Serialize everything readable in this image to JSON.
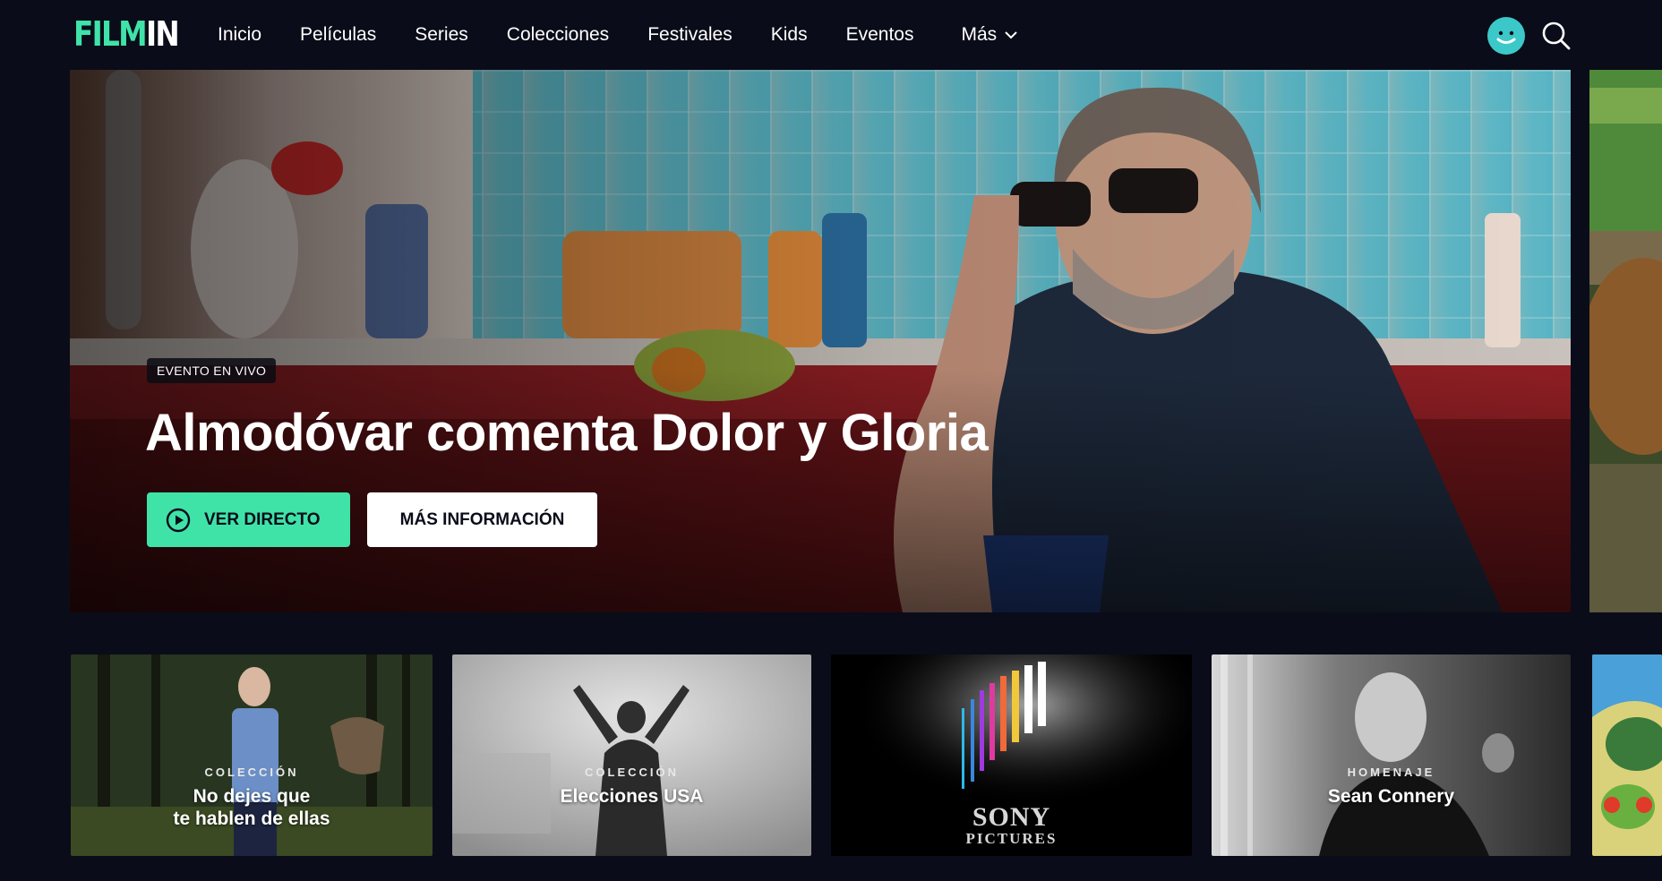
{
  "brand": {
    "logo_primary": "FILM",
    "logo_secondary": "IN",
    "accent_color": "#3fe3a8"
  },
  "nav": {
    "items": [
      "Inicio",
      "Películas",
      "Series",
      "Colecciones",
      "Festivales",
      "Kids",
      "Eventos"
    ],
    "more_label": "Más",
    "avatar_icon": "avatar-smiley-icon",
    "search_icon": "search-icon"
  },
  "hero": {
    "badge": "EVENTO EN VIVO",
    "title": "Almodóvar comenta Dolor y Gloria",
    "primary_button": "VER DIRECTO",
    "secondary_button": "MÁS INFORMACIÓN"
  },
  "row": {
    "cards": [
      {
        "kicker": "COLECCIÓN",
        "title_line1": "No dejes que",
        "title_line2": "te hablen de ellas"
      },
      {
        "kicker": "COLECCIÓN",
        "title_line1": "Elecciones USA",
        "title_line2": ""
      },
      {
        "logo_line1": "SONY",
        "logo_line2": "PICTURES"
      },
      {
        "kicker": "HOMENAJE",
        "title_line1": "Sean Connery",
        "title_line2": ""
      }
    ]
  }
}
